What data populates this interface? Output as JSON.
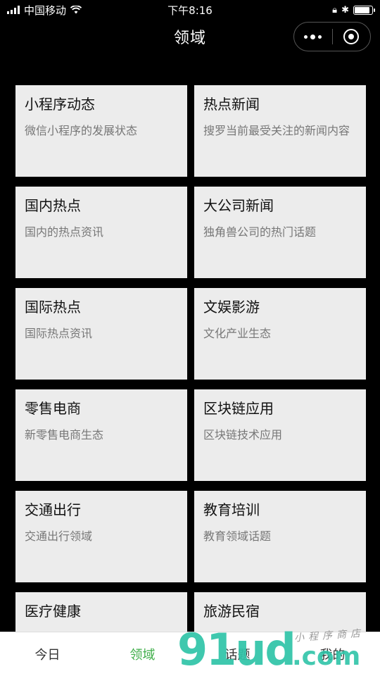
{
  "status_bar": {
    "carrier": "中国移动",
    "time": "下午8:16",
    "signal_bars": 4,
    "battery_level": 0.9
  },
  "nav": {
    "title": "领域",
    "more_icon": "more-dots-icon",
    "close_icon": "target-circle-icon"
  },
  "cards": [
    {
      "title": "小程序动态",
      "desc": "微信小程序的发展状态"
    },
    {
      "title": "热点新闻",
      "desc": "搜罗当前最受关注的新闻内容"
    },
    {
      "title": "国内热点",
      "desc": "国内的热点资讯"
    },
    {
      "title": "大公司新闻",
      "desc": "独角兽公司的热门话题"
    },
    {
      "title": "国际热点",
      "desc": "国际热点资讯"
    },
    {
      "title": "文娱影游",
      "desc": "文化产业生态"
    },
    {
      "title": "零售电商",
      "desc": "新零售电商生态"
    },
    {
      "title": "区块链应用",
      "desc": "区块链技术应用"
    },
    {
      "title": "交通出行",
      "desc": "交通出行领域"
    },
    {
      "title": "教育培训",
      "desc": "教育领域话题"
    },
    {
      "title": "医疗健康",
      "desc": ""
    },
    {
      "title": "旅游民宿",
      "desc": ""
    }
  ],
  "tabs": [
    {
      "label": "今日",
      "active": false
    },
    {
      "label": "领域",
      "active": true
    },
    {
      "label": "话题",
      "active": false
    },
    {
      "label": "我的",
      "active": false
    }
  ],
  "watermark": {
    "brand": "91ud",
    "domain": ".com",
    "tagline": "小程序商店"
  },
  "colors": {
    "active_tab": "#3fae49",
    "card_bg": "#ececec",
    "watermark": "#2fc4a8"
  }
}
